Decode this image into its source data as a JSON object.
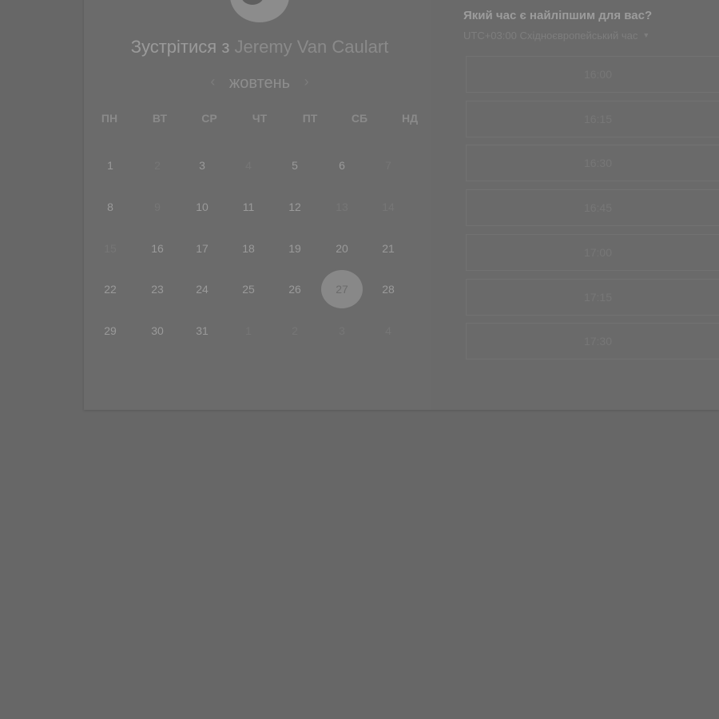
{
  "meeting": {
    "title_prefix": "Зустрітися з",
    "host_name": "Jeremy Van Caulart"
  },
  "calendar": {
    "month": "жовтень",
    "prev_icon": "chevron-left-icon",
    "next_icon": "chevron-right-icon",
    "weekdays": [
      "ПН",
      "ВТ",
      "СР",
      "ЧТ",
      "ПТ",
      "СБ",
      "НД"
    ],
    "weeks": [
      [
        {
          "d": "1",
          "m": false
        },
        {
          "d": "2",
          "m": true
        },
        {
          "d": "3",
          "m": false
        },
        {
          "d": "4",
          "m": true
        },
        {
          "d": "5",
          "m": false
        },
        {
          "d": "6",
          "m": false
        },
        {
          "d": "7",
          "m": true
        }
      ],
      [
        {
          "d": "8",
          "m": false
        },
        {
          "d": "9",
          "m": true
        },
        {
          "d": "10",
          "m": false
        },
        {
          "d": "11",
          "m": false
        },
        {
          "d": "12",
          "m": false
        },
        {
          "d": "13",
          "m": true
        },
        {
          "d": "14",
          "m": true
        }
      ],
      [
        {
          "d": "15",
          "m": true
        },
        {
          "d": "16",
          "m": false
        },
        {
          "d": "17",
          "m": false
        },
        {
          "d": "18",
          "m": false
        },
        {
          "d": "19",
          "m": false
        },
        {
          "d": "20",
          "m": false
        },
        {
          "d": "21",
          "m": false
        }
      ],
      [
        {
          "d": "22",
          "m": false
        },
        {
          "d": "23",
          "m": false
        },
        {
          "d": "24",
          "m": false
        },
        {
          "d": "25",
          "m": false
        },
        {
          "d": "26",
          "m": false
        },
        {
          "d": "27",
          "m": false
        },
        {
          "d": "28",
          "m": false
        }
      ],
      [
        {
          "d": "29",
          "m": false
        },
        {
          "d": "30",
          "m": false
        },
        {
          "d": "31",
          "m": false
        },
        {
          "d": "1",
          "m": true
        },
        {
          "d": "2",
          "m": true
        },
        {
          "d": "3",
          "m": true
        },
        {
          "d": "4",
          "m": true
        }
      ]
    ],
    "selected_day": "27"
  },
  "time_picker": {
    "question": "Який час є найліпшим для вас?",
    "timezone": "UTC+03:00 Східноєвропейський час",
    "slots": [
      "16:00",
      "16:15",
      "16:30",
      "16:45",
      "17:00",
      "17:15",
      "17:30"
    ]
  }
}
